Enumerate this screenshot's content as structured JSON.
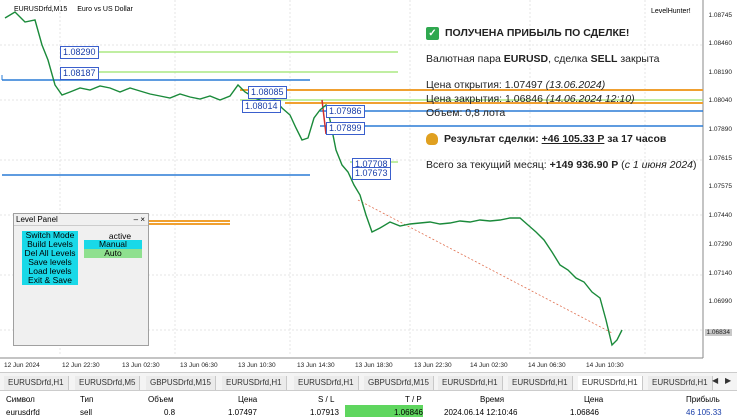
{
  "chart": {
    "symbol": "EURUSDrfd,M15",
    "description": "Euro vs US Dollar",
    "indicator": "LevelHunter!",
    "price_ticks": [
      "1.08745",
      "1.08460",
      "1.08190",
      "1.08040",
      "1.07890",
      "1.07615",
      "1.07575",
      "1.07440",
      "1.07290",
      "1.07140",
      "1.06990",
      "1.06834"
    ],
    "current_price": "1.06834",
    "time_ticks": [
      "12 Jun 2024",
      "12 Jun 22:30",
      "13 Jun 02:30",
      "13 Jun 06:30",
      "13 Jun 10:30",
      "13 Jun 14:30",
      "13 Jun 18:30",
      "13 Jun 22:30",
      "14 Jun 02:30",
      "14 Jun 06:30",
      "14 Jun 10:30"
    ],
    "level_labels": [
      "1.08290",
      "1.08187",
      "1.08085",
      "1.08014",
      "1.07986",
      "1.07899",
      "1.07708",
      "1.07673"
    ]
  },
  "panel": {
    "title": "Level Panel",
    "ctrl": "– ×",
    "buttons": [
      "Switch Mode",
      "Build Levels",
      "Del All Levels",
      "Save levels",
      "Load levels",
      "Exit & Save"
    ],
    "state_active": "active",
    "state_manual": "Manual",
    "state_auto": "Auto"
  },
  "info": {
    "headline": "ПОЛУЧЕНА ПРИБЫЛЬ ПО СДЕЛКЕ!",
    "pair_prefix": "Валютная пара ",
    "pair": "EURUSD",
    "pair_mid": ", сделка ",
    "side": "SELL",
    "pair_suffix": " закрыта",
    "open_label": "Цена открытия: 1.07497 ",
    "open_date": "(13.06.2024)",
    "close_label": "Цена закрытия: 1.06846 ",
    "close_date": "(14.06.2024 12:10)",
    "volume": "Объем: 0,8 лота",
    "result_label": "Результат сделки: ",
    "result_value": "+46 105.33 Р",
    "result_suffix": " за 17 часов",
    "month_label": "Всего за текущий месяц: ",
    "month_value": "+149 936.90 Р",
    "month_paren_open": " (",
    "month_since": "с 1 июня 2024",
    "month_paren_close": ")"
  },
  "tabs": [
    "EURUSDrfd,H1",
    "EURUSDrfd,M5",
    "GBPUSDrfd,M15",
    "EURUSDrfd,H1",
    "EURUSDrfd,H1",
    "GBPUSDrfd,M15",
    "EURUSDrfd,H1",
    "EURUSDrfd,H1",
    "EURUSDrfd,H1",
    "EURUSDrfd,H1",
    "EURUSDrfd,H1"
  ],
  "table": {
    "headers": [
      "Символ",
      "Тип",
      "Объем",
      "Цена",
      "S / L",
      "T / P",
      "Время",
      "Цена",
      "Прибыль"
    ],
    "row": [
      "eurusdrfd",
      "sell",
      "0.8",
      "1.07497",
      "1.07913",
      "1.06846",
      "2024.06.14 12:10:46",
      "1.06846",
      "46 105.33"
    ]
  },
  "colors": {
    "profit": "#1a3ea8",
    "tp_bg": "#5fd65f",
    "level_blue": "#2a7bd5",
    "level_green": "#9be36b",
    "level_orange": "#f0a030"
  }
}
